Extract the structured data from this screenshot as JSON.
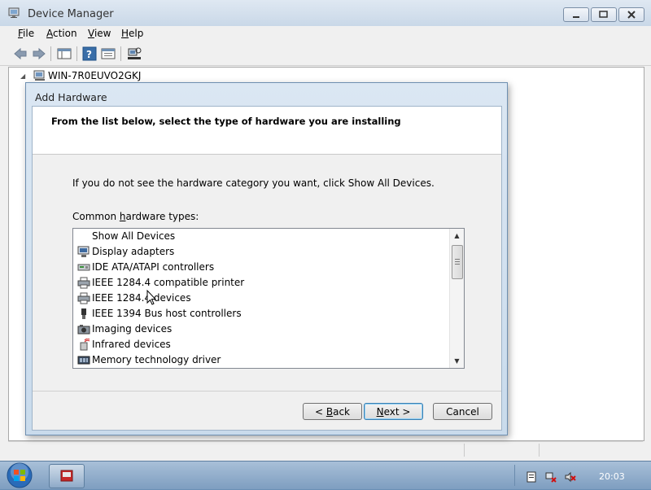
{
  "window": {
    "title": "Device Manager"
  },
  "menu": {
    "file": "File",
    "action": "Action",
    "view": "View",
    "help": "Help"
  },
  "tree": {
    "root_label": "WIN-7R0EUVO2GKJ"
  },
  "dialog": {
    "title": "Add Hardware",
    "header": "From the list below, select the type of hardware you are installing",
    "info": "If you do not see the hardware category you want, click Show All Devices.",
    "list_label_pre": "Common ",
    "list_label_ul": "h",
    "list_label_post": "ardware types:",
    "items": [
      {
        "label": "Show All Devices",
        "icon": "none"
      },
      {
        "label": "Display adapters",
        "icon": "monitor-icon"
      },
      {
        "label": "IDE ATA/ATAPI controllers",
        "icon": "drive-icon"
      },
      {
        "label": "IEEE 1284.4 compatible printer",
        "icon": "printer-icon"
      },
      {
        "label": "IEEE 1284.4 devices",
        "icon": "printer-icon"
      },
      {
        "label": "IEEE 1394 Bus host controllers",
        "icon": "plug-icon"
      },
      {
        "label": "Imaging devices",
        "icon": "camera-icon"
      },
      {
        "label": "Infrared devices",
        "icon": "infrared-icon"
      },
      {
        "label": "Memory technology driver",
        "icon": "memory-icon"
      }
    ],
    "buttons": {
      "back_pre": "< ",
      "back_ul": "B",
      "back_post": "ack",
      "next_ul": "N",
      "next_post": "ext >",
      "cancel": "Cancel"
    }
  },
  "taskbar": {
    "clock": "20:03"
  },
  "colors": {
    "selection_blue": "#3c7fb1",
    "title_gradient_top": "#dfe8f2",
    "taskbar": "#7e9ec0"
  }
}
